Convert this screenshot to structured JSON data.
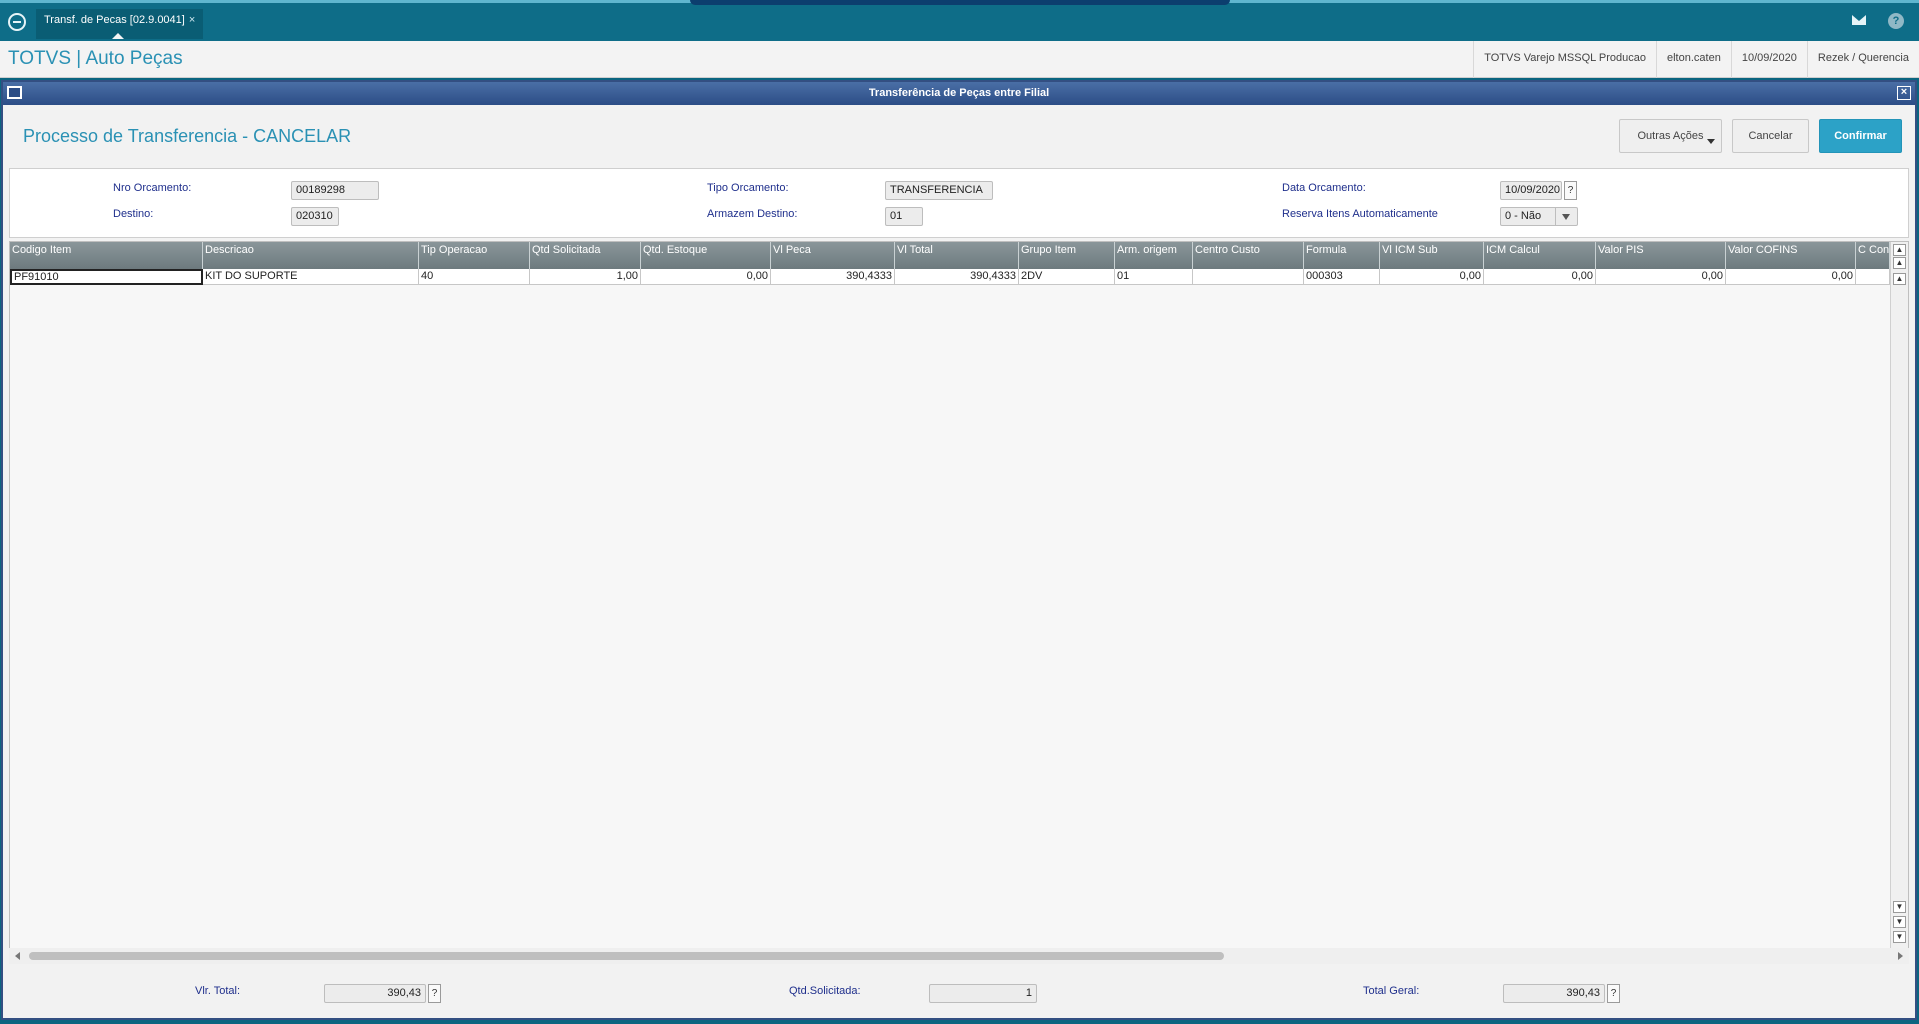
{
  "topbar": {
    "tab_label": "Transf. de Pecas [02.9.0041]",
    "tab_close": "×"
  },
  "header": {
    "title": "TOTVS | Auto Peças",
    "environment": "TOTVS Varejo MSSQL Producao",
    "user": "elton.caten",
    "date": "10/09/2020",
    "branch": "Rezek / Querencia"
  },
  "dialog": {
    "title": "Transferência de Peças entre Filial",
    "process_title": "Processo de Transferencia - CANCELAR",
    "buttons": {
      "other_actions": "Outras Ações",
      "cancel": "Cancelar",
      "confirm": "Confirmar"
    }
  },
  "form": {
    "nro_orcamento": {
      "label": "Nro Orcamento:",
      "value": "00189298"
    },
    "destino": {
      "label": "Destino:",
      "value": "020310"
    },
    "tipo_orcamento": {
      "label": "Tipo Orcamento:",
      "value": "TRANSFERENCIA"
    },
    "armazem_destino": {
      "label": "Armazem Destino:",
      "value": "01"
    },
    "data_orcamento": {
      "label": "Data Orcamento:",
      "value": "10/09/2020"
    },
    "reserva_itens": {
      "label": "Reserva Itens Automaticamente",
      "value": "0 - Não"
    },
    "help_glyph": "?"
  },
  "grid": {
    "columns": [
      "Codigo Item",
      "Descricao",
      "Tip Operacao",
      "Qtd Solicitada",
      "Qtd. Estoque",
      "Vl Peca",
      "Vl Total",
      "Grupo Item",
      "Arm. origem",
      "Centro Custo",
      "Formula",
      "Vl ICM Sub",
      "ICM Calcul",
      "Valor PIS",
      "Valor COFINS",
      "C Conta"
    ],
    "rows": [
      [
        "PF91010",
        "KIT DO SUPORTE",
        "40",
        "1,00",
        "0,00",
        "390,4333",
        "390,4333",
        "2DV",
        "01",
        "",
        "000303",
        "0,00",
        "0,00",
        "0,00",
        "0,00",
        ""
      ]
    ]
  },
  "footer": {
    "vlr_total": {
      "label": "Vlr. Total:",
      "value": "390,43"
    },
    "qtd_solicitada": {
      "label": "Qtd.Solicitada:",
      "value": "1"
    },
    "total_geral": {
      "label": "Total Geral:",
      "value": "390,43"
    }
  }
}
